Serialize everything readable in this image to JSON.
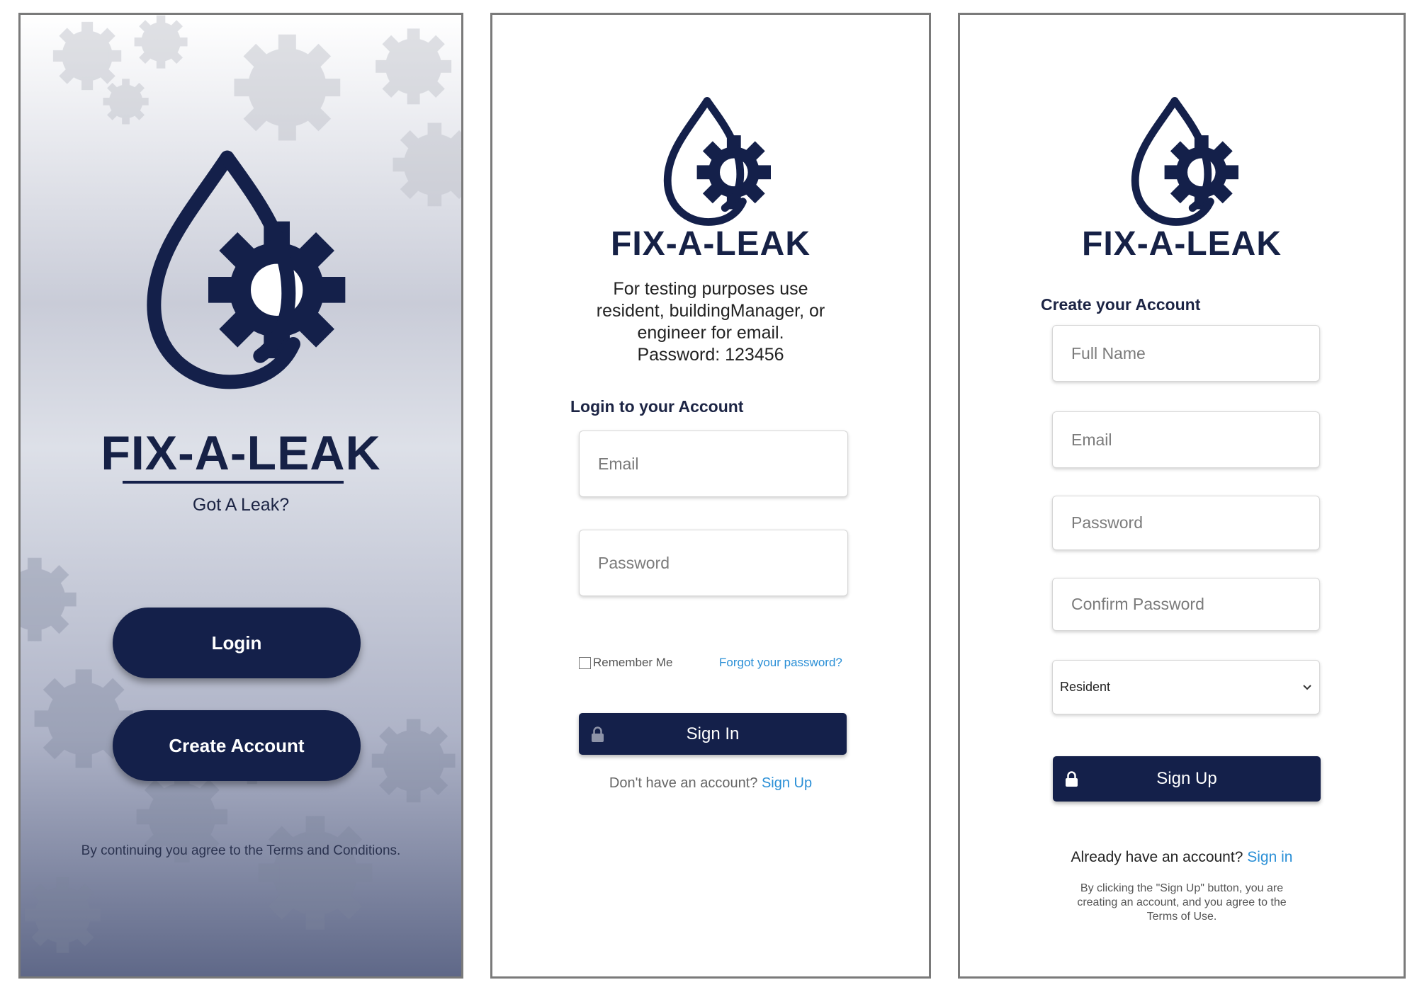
{
  "colors": {
    "navy": "#14204a",
    "link": "#2a8fd6",
    "border": "#7a7a7a"
  },
  "icons": {
    "logo": "water-drop-gear-logo",
    "lock": "lock-icon",
    "chevron": "chevron-down-icon",
    "checkbox": "checkbox-icon"
  },
  "welcome": {
    "brand": "FIX-A-LEAK",
    "tagline": "Got A Leak?",
    "login_label": "Login",
    "create_label": "Create Account",
    "terms": "By continuing you agree to the Terms and Conditions."
  },
  "login": {
    "brand": "FIX-A-LEAK",
    "hint_line1": "For testing purposes use",
    "hint_line2": "resident, buildingManager, or",
    "hint_line3": "engineer for email.",
    "hint_line4": "Password: 123456",
    "title": "Login to your Account",
    "email_placeholder": "Email",
    "password_placeholder": "Password",
    "remember_label": "Remember Me",
    "forgot_label": "Forgot your password?",
    "signin_label": "Sign In",
    "no_account": "Don't have an account?",
    "signup_link": "Sign Up"
  },
  "signup": {
    "brand": "FIX-A-LEAK",
    "title": "Create your Account",
    "fullname_placeholder": "Full Name",
    "email_placeholder": "Email",
    "password_placeholder": "Password",
    "confirm_placeholder": "Confirm Password",
    "role_selected": "Resident",
    "signup_label": "Sign Up",
    "have_account": "Already have an account?",
    "signin_link": "Sign in",
    "disclaimer_line1": "By clicking the \"Sign Up\" button, you are",
    "disclaimer_line2": "creating an account, and you agree to the",
    "disclaimer_line3": "Terms of Use."
  }
}
